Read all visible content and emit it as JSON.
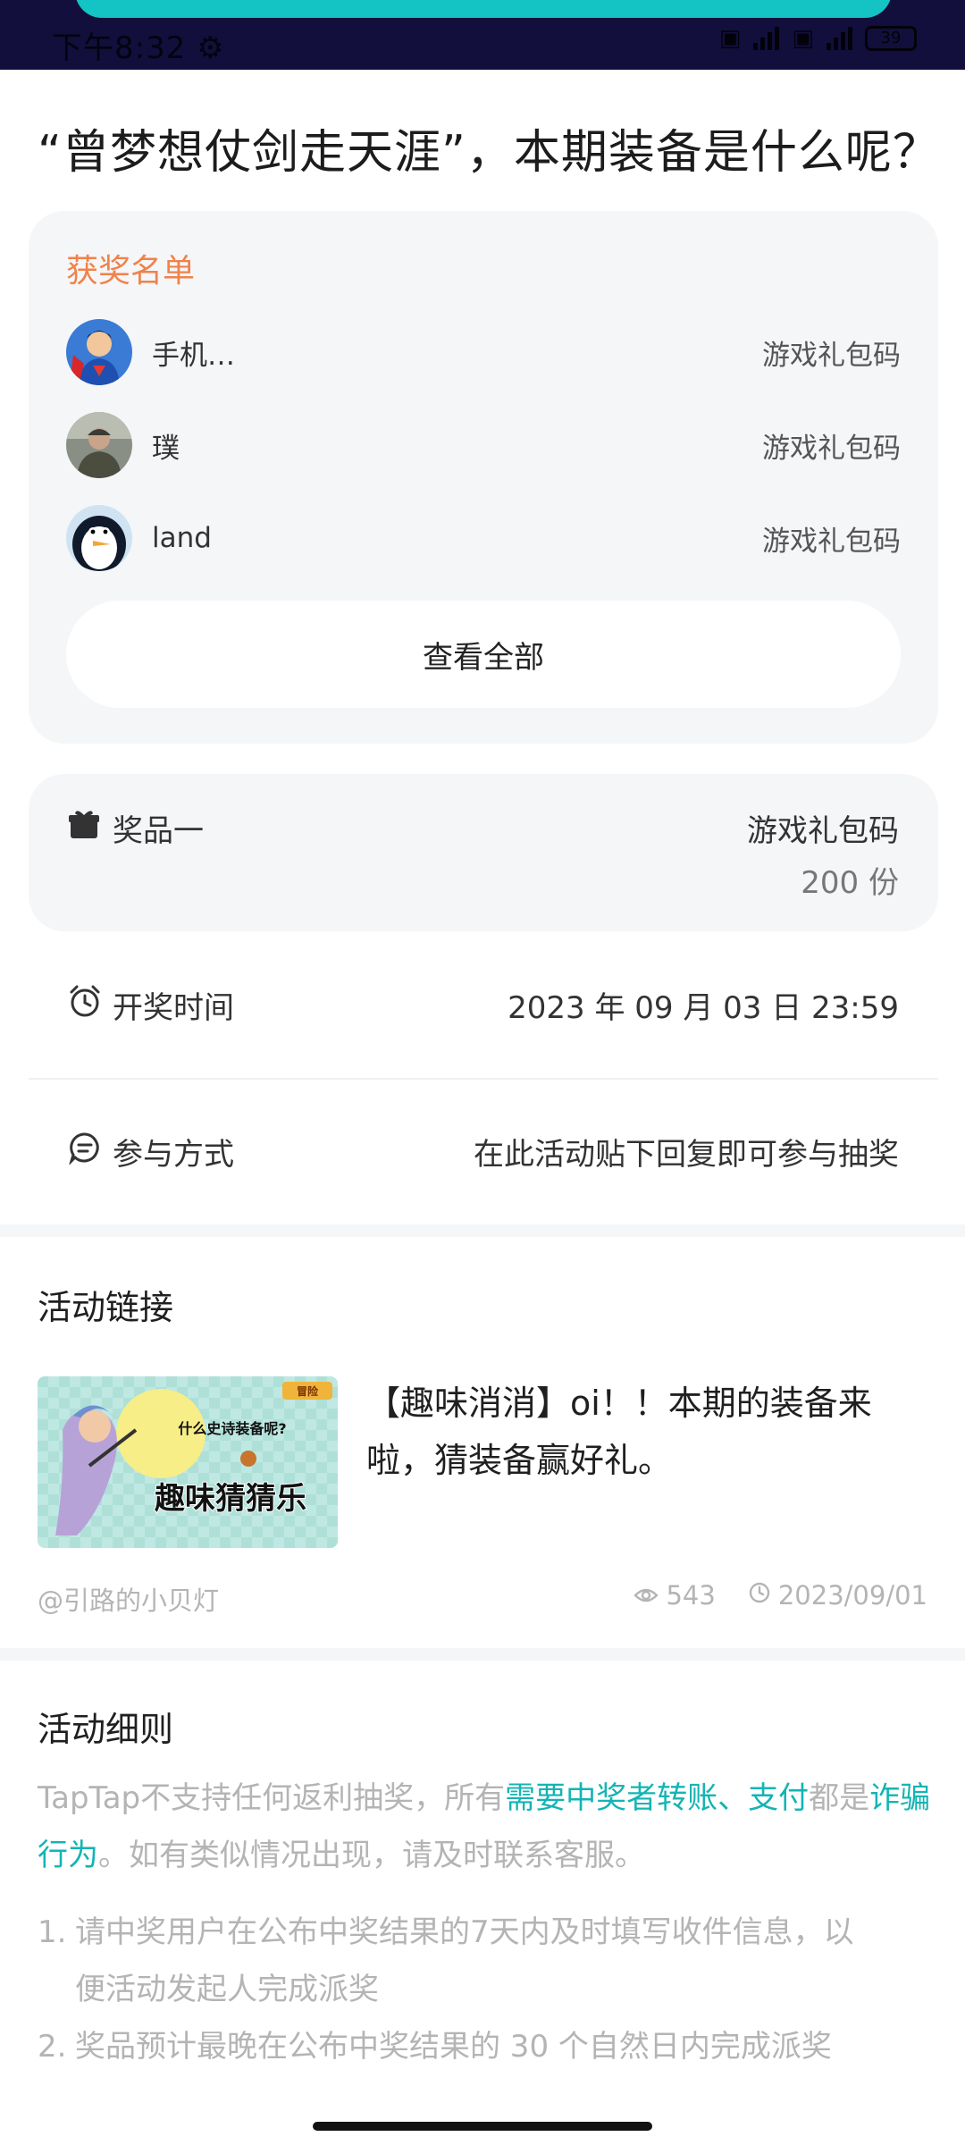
{
  "status_bar": {
    "time": "下午8:32 ⚙",
    "battery": "39"
  },
  "page_title": "“曾梦想仗剑走天涯”，本期装备是什么呢？",
  "winners": {
    "heading": "获奖名单",
    "rows": [
      {
        "name": "手机…",
        "prize": "游戏礼包码"
      },
      {
        "name": "璞",
        "prize": "游戏礼包码"
      },
      {
        "name": "land",
        "prize": "游戏礼包码"
      }
    ],
    "view_all_label": "查看全部"
  },
  "prize": {
    "label": "奖品一",
    "name": "游戏礼包码",
    "quantity": "200 份"
  },
  "draw_time": {
    "label": "开奖时间",
    "value": "2023 年 09 月 03 日 23:59"
  },
  "participation": {
    "label": "参与方式",
    "value": "在此活动贴下回复即可参与抽奖"
  },
  "activity_link": {
    "section_title": "活动链接",
    "thumbnail": {
      "text_top": "什么史诗装备呢?",
      "text_main": "趣味猜猜乐",
      "badge": "冒险"
    },
    "title": "【趣味消消】oi！！本期的装备来啦，猜装备赢好礼。",
    "author": "@引路的小贝灯",
    "views": "543",
    "date": "2023/09/01"
  },
  "rules": {
    "section_title": "活动细则",
    "intro_1": "TapTap不支持任何返利抽奖，所有",
    "intro_hl_1": "需要中奖者转账、支付",
    "intro_2": "都是",
    "intro_hl_2": "诈骗行为",
    "intro_3": "。如有类似情况出现，请及时联系客服。",
    "items": [
      {
        "num": "1.",
        "text_line1": "请中奖用户在公布中奖结果的7天内及时填写收件信息，以",
        "text_line2": "便活动发起人完成派奖"
      },
      {
        "num": "2.",
        "text_line1": "奖品预计最晚在公布中奖结果的 30 个自然日内完成派奖"
      }
    ]
  }
}
